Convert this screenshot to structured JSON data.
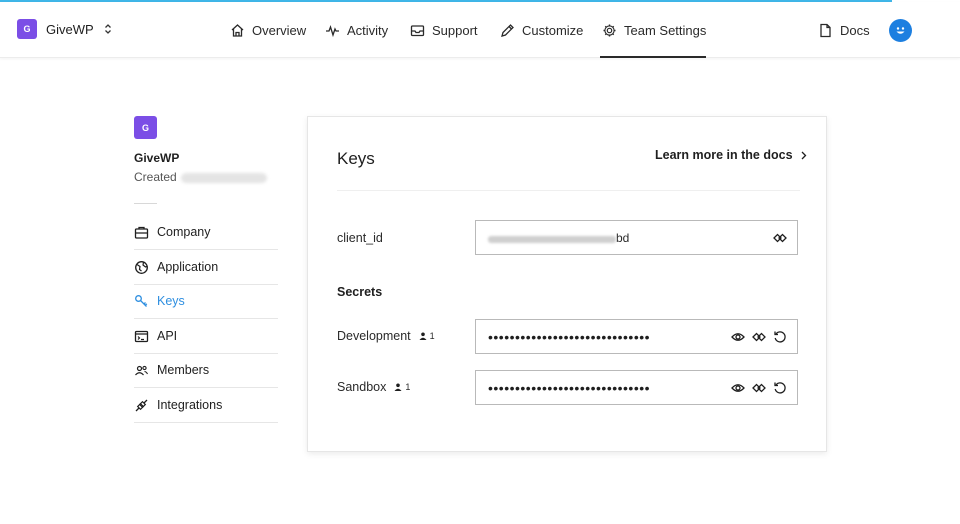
{
  "brand": {
    "logo_letter": "G",
    "name": "GiveWP"
  },
  "nav": {
    "items": [
      {
        "label": "Overview",
        "icon": "home-icon"
      },
      {
        "label": "Activity",
        "icon": "activity-icon"
      },
      {
        "label": "Support",
        "icon": "inbox-icon"
      },
      {
        "label": "Customize",
        "icon": "pencil-icon"
      },
      {
        "label": "Team Settings",
        "icon": "gear-icon",
        "active": true
      }
    ],
    "docs_label": "Docs"
  },
  "sidebar": {
    "logo_letter": "G",
    "team_name": "GiveWP",
    "created_label": "Created",
    "items": [
      {
        "label": "Company",
        "icon": "briefcase-icon"
      },
      {
        "label": "Application",
        "icon": "globe-icon"
      },
      {
        "label": "Keys",
        "icon": "key-icon",
        "active": true
      },
      {
        "label": "API",
        "icon": "terminal-icon"
      },
      {
        "label": "Members",
        "icon": "members-icon"
      },
      {
        "label": "Integrations",
        "icon": "plug-icon"
      }
    ]
  },
  "keys": {
    "title": "Keys",
    "learn_more": "Learn more in the docs",
    "client_id_label": "client_id",
    "client_id_suffix": "bd",
    "secrets_heading": "Secrets",
    "secrets": [
      {
        "label": "Development",
        "count": "1",
        "value": "••••••••••••••••••••••••••••••"
      },
      {
        "label": "Sandbox",
        "count": "1",
        "value": "••••••••••••••••••••••••••••••"
      }
    ]
  },
  "colors": {
    "accent": "#2f8fe0",
    "brand": "#7b4ee6",
    "top_line": "#3fb6e8",
    "avatar": "#1d7fe0"
  }
}
